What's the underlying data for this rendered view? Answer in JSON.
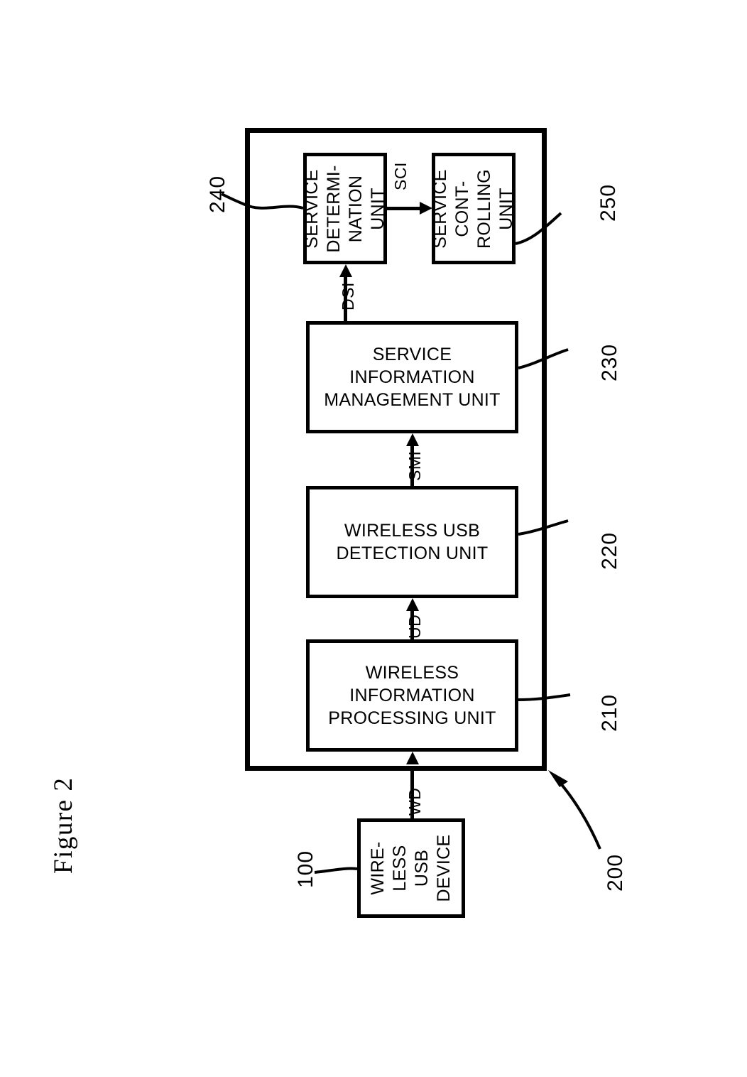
{
  "figure": {
    "title": "Figure 2"
  },
  "system": {
    "ref": "200"
  },
  "blocks": [
    {
      "id": "service-determination-unit",
      "label": "SERVICE\nDETERMI-\nNATION\nUNIT",
      "ref": "240",
      "orientation": "vertical"
    },
    {
      "id": "service-controlling-unit",
      "label": "SERVICE\nCONT-\nROLLING\nUNIT",
      "ref": "250",
      "orientation": "vertical"
    },
    {
      "id": "service-information-management-unit",
      "label": "SERVICE\nINFORMATION\nMANAGEMENT UNIT",
      "ref": "230",
      "orientation": "horizontal"
    },
    {
      "id": "wireless-usb-detection-unit",
      "label": "WIRELESS USB\nDETECTION UNIT",
      "ref": "220",
      "orientation": "horizontal"
    },
    {
      "id": "wireless-information-processing-unit",
      "label": "WIRELESS\nINFORMATION\nPROCESSING UNIT",
      "ref": "210",
      "orientation": "horizontal"
    },
    {
      "id": "wireless-usb-device",
      "label": "WIRE-\nLESS\nUSB\nDEVICE",
      "ref": "100",
      "orientation": "vertical"
    }
  ],
  "signals": {
    "sci": "SCI",
    "dsi": "DSI",
    "smi": "SMI",
    "ud": "UD",
    "wd": "WD"
  }
}
